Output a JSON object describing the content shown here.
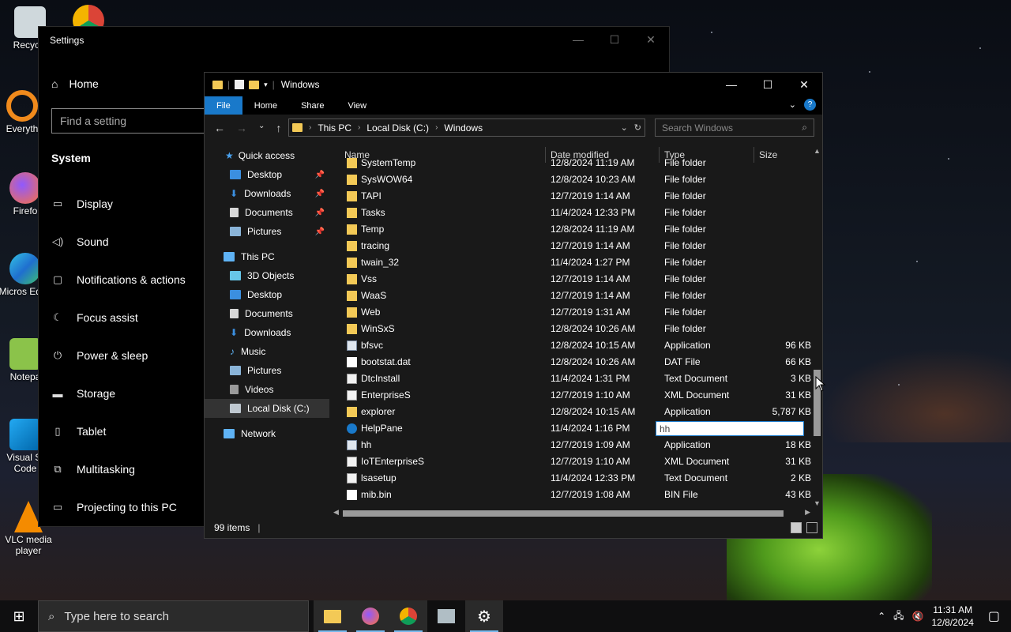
{
  "desktop": {
    "icons": [
      {
        "label": "Recycle"
      },
      {
        "label": "Everyth"
      },
      {
        "label": "Firefo"
      },
      {
        "label": "Micros Edge"
      },
      {
        "label": "Notepa"
      },
      {
        "label": "Visual St Code"
      },
      {
        "label": "VLC media player"
      }
    ]
  },
  "settings": {
    "title": "Settings",
    "home": "Home",
    "search_placeholder": "Find a setting",
    "section": "System",
    "menu": [
      {
        "label": "Display",
        "icon": "display-icon"
      },
      {
        "label": "Sound",
        "icon": "sound-icon"
      },
      {
        "label": "Notifications & actions",
        "icon": "notifications-icon"
      },
      {
        "label": "Focus assist",
        "icon": "moon-icon"
      },
      {
        "label": "Power & sleep",
        "icon": "power-icon"
      },
      {
        "label": "Storage",
        "icon": "storage-icon"
      },
      {
        "label": "Tablet",
        "icon": "tablet-icon"
      },
      {
        "label": "Multitasking",
        "icon": "multitasking-icon"
      },
      {
        "label": "Projecting to this PC",
        "icon": "projecting-icon"
      }
    ]
  },
  "explorer": {
    "title": "Windows",
    "ribbon_tabs": [
      "File",
      "Home",
      "Share",
      "View"
    ],
    "breadcrumb": [
      "This PC",
      "Local Disk (C:)",
      "Windows"
    ],
    "search_placeholder": "Search Windows",
    "nav": {
      "quick_access": "Quick access",
      "quick_items": [
        "Desktop",
        "Downloads",
        "Documents",
        "Pictures"
      ],
      "this_pc": "This PC",
      "pc_items": [
        "3D Objects",
        "Desktop",
        "Documents",
        "Downloads",
        "Music",
        "Pictures",
        "Videos",
        "Local Disk (C:)"
      ],
      "network": "Network"
    },
    "columns": [
      "Name",
      "Date modified",
      "Type",
      "Size"
    ],
    "files": [
      {
        "name": "SystemTemp",
        "date": "12/8/2024 11:19 AM",
        "type": "File folder",
        "size": "",
        "kind": "folder"
      },
      {
        "name": "SysWOW64",
        "date": "12/8/2024 10:23 AM",
        "type": "File folder",
        "size": "",
        "kind": "folder"
      },
      {
        "name": "TAPI",
        "date": "12/7/2019 1:14 AM",
        "type": "File folder",
        "size": "",
        "kind": "folder"
      },
      {
        "name": "Tasks",
        "date": "11/4/2024 12:33 PM",
        "type": "File folder",
        "size": "",
        "kind": "folder"
      },
      {
        "name": "Temp",
        "date": "12/8/2024 11:19 AM",
        "type": "File folder",
        "size": "",
        "kind": "folder"
      },
      {
        "name": "tracing",
        "date": "12/7/2019 1:14 AM",
        "type": "File folder",
        "size": "",
        "kind": "folder"
      },
      {
        "name": "twain_32",
        "date": "11/4/2024 1:27 PM",
        "type": "File folder",
        "size": "",
        "kind": "folder"
      },
      {
        "name": "Vss",
        "date": "12/7/2019 1:14 AM",
        "type": "File folder",
        "size": "",
        "kind": "folder"
      },
      {
        "name": "WaaS",
        "date": "12/7/2019 1:14 AM",
        "type": "File folder",
        "size": "",
        "kind": "folder"
      },
      {
        "name": "Web",
        "date": "12/7/2019 1:31 AM",
        "type": "File folder",
        "size": "",
        "kind": "folder"
      },
      {
        "name": "WinSxS",
        "date": "12/8/2024 10:26 AM",
        "type": "File folder",
        "size": "",
        "kind": "folder"
      },
      {
        "name": "bfsvc",
        "date": "12/8/2024 10:15 AM",
        "type": "Application",
        "size": "96 KB",
        "kind": "app"
      },
      {
        "name": "bootstat.dat",
        "date": "12/8/2024 10:26 AM",
        "type": "DAT File",
        "size": "66 KB",
        "kind": "file"
      },
      {
        "name": "DtcInstall",
        "date": "11/4/2024 1:31 PM",
        "type": "Text Document",
        "size": "3 KB",
        "kind": "text"
      },
      {
        "name": "EnterpriseS",
        "date": "12/7/2019 1:10 AM",
        "type": "XML Document",
        "size": "31 KB",
        "kind": "text"
      },
      {
        "name": "explorer",
        "date": "12/8/2024 10:15 AM",
        "type": "Application",
        "size": "5,787 KB",
        "kind": "folder"
      },
      {
        "name": "HelpPane",
        "date": "11/4/2024 1:16 PM",
        "type": "",
        "size": "",
        "kind": "help"
      },
      {
        "name": "hh",
        "date": "12/7/2019 1:09 AM",
        "type": "Application",
        "size": "18 KB",
        "kind": "app"
      },
      {
        "name": "IoTEnterpriseS",
        "date": "12/7/2019 1:10 AM",
        "type": "XML Document",
        "size": "31 KB",
        "kind": "text"
      },
      {
        "name": "lsasetup",
        "date": "11/4/2024 12:33 PM",
        "type": "Text Document",
        "size": "2 KB",
        "kind": "text"
      },
      {
        "name": "mib.bin",
        "date": "12/7/2019 1:08 AM",
        "type": "BIN File",
        "size": "43 KB",
        "kind": "file"
      }
    ],
    "rename_value": "hh",
    "status": "99 items"
  },
  "taskbar": {
    "search_placeholder": "Type here to search",
    "time": "11:31 AM",
    "date": "12/8/2024"
  },
  "colors": {
    "accent": "#1979ca",
    "folder": "#f3c956"
  }
}
